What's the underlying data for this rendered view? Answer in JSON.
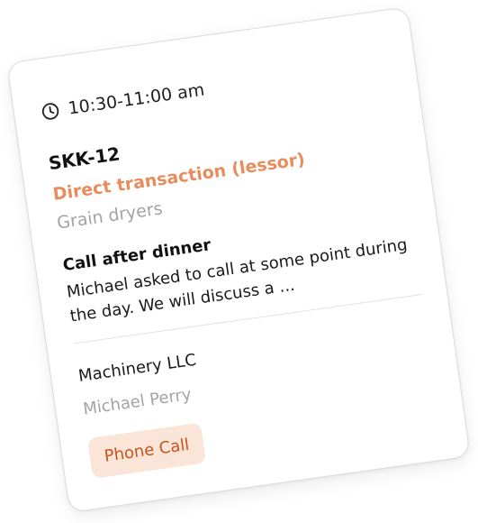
{
  "card": {
    "time": "10:30-11:00 am",
    "code": "SKK-12",
    "deal_type": "Direct transaction (lessor)",
    "category": "Grain dryers",
    "note_title": "Call after dinner",
    "note_body": "Michael asked to call at some point during the day. We will discuss a ...",
    "company": "Machinery LLC",
    "contact": "Michael Perry",
    "tag": "Phone Call",
    "icons": {
      "time": "clock-icon"
    },
    "colors": {
      "accent": "#e98c5d",
      "muted": "#a3a3a3",
      "tag_bg": "#fbe4d8",
      "tag_text": "#c7561a"
    }
  }
}
